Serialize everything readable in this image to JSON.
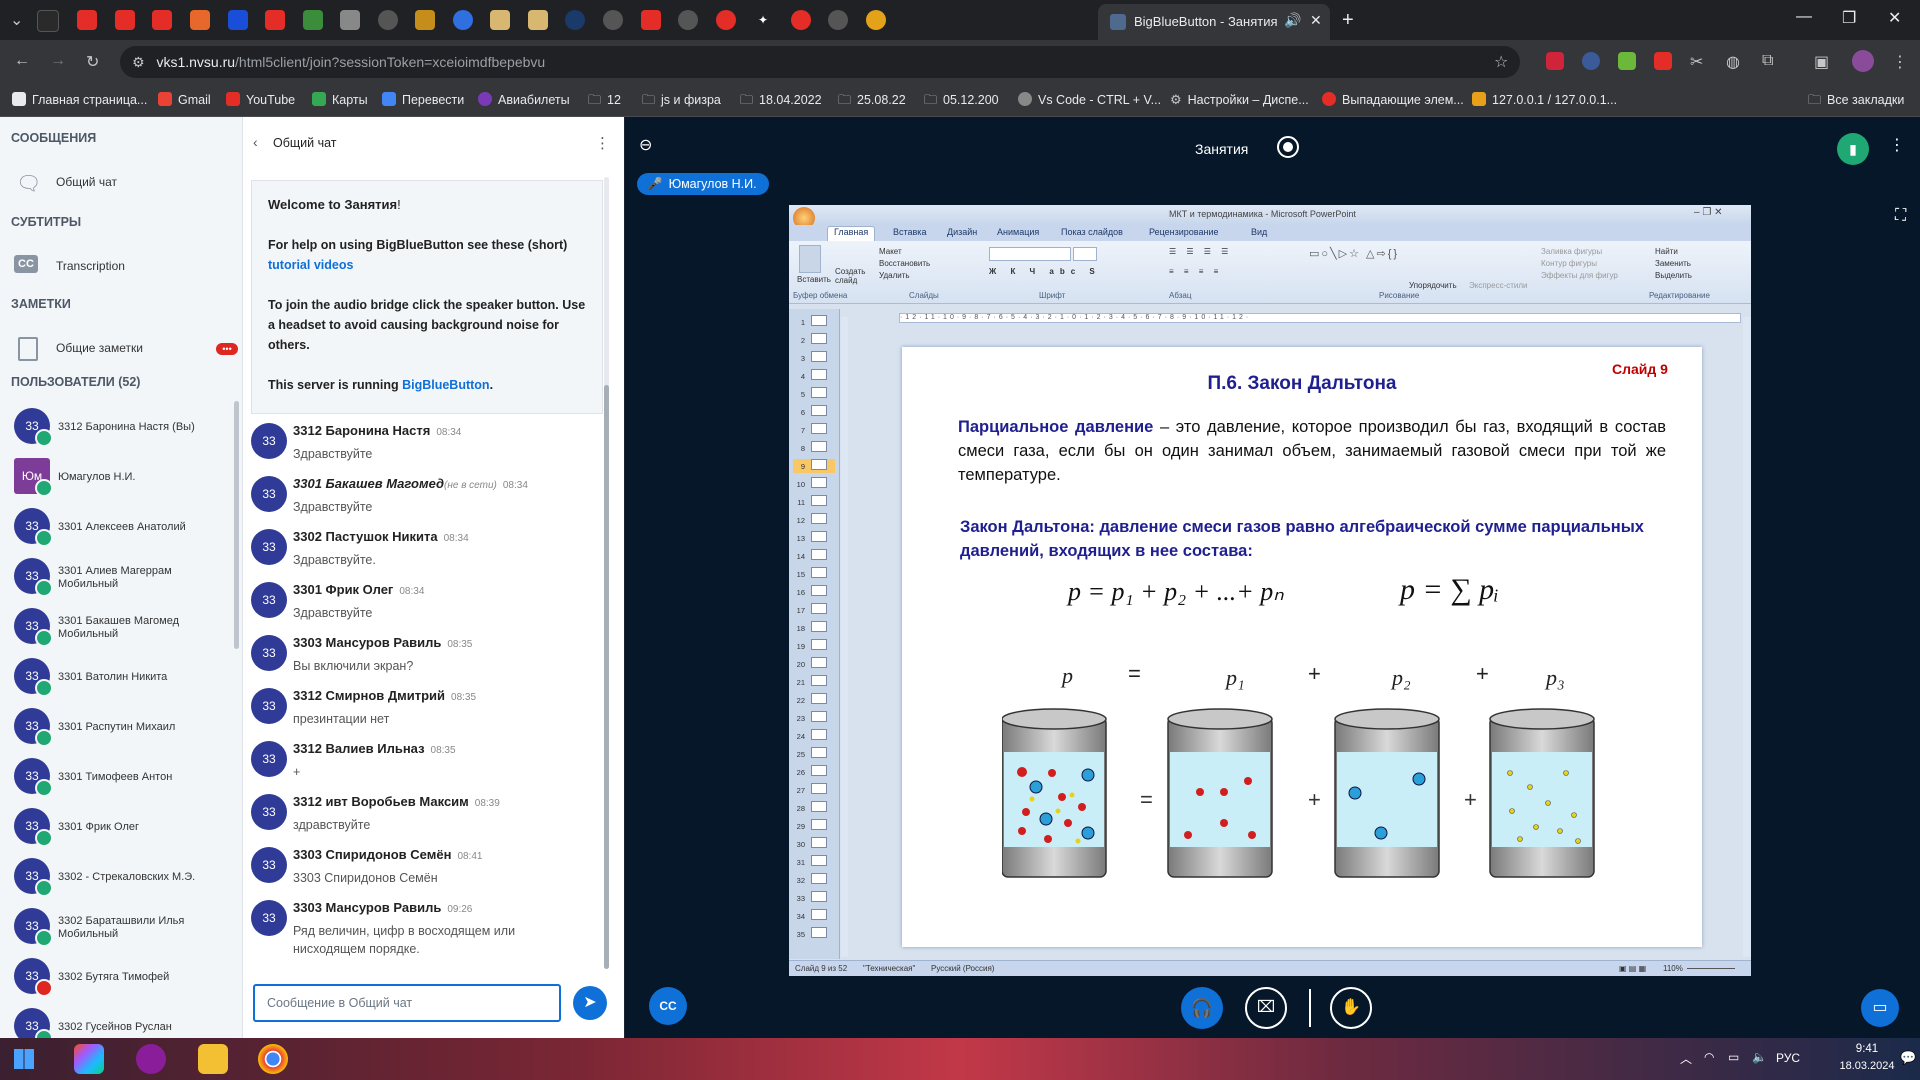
{
  "browser": {
    "active_tab_title": "BigBlueButton - Занятия",
    "url_host": "vks1.nvsu.ru",
    "url_path": "/html5client/join?sessionToken=xceioimdfbepebvu",
    "bookmarks": [
      "Главная страница...",
      "Gmail",
      "YouTube",
      "Карты",
      "Перевести",
      "Авиабилеты",
      "12",
      "js и физра",
      "18.04.2022",
      "25.08.22",
      "05.12.200",
      "Vs Code - CTRL + V...",
      "Настройки – Диспе...",
      "Выпадающие элем...",
      "127.0.0.1 / 127.0.0.1..."
    ],
    "all_bookmarks": "Все закладки"
  },
  "sidebar": {
    "messages_header": "СООБЩЕНИЯ",
    "public_chat": "Общий чат",
    "captions_header": "СУБТИТРЫ",
    "transcription": "Transcription",
    "notes_header": "ЗАМЕТКИ",
    "shared_notes": "Общие заметки",
    "users_header": "ПОЛЬЗОВАТЕЛИ (52)",
    "users": [
      {
        "avatar": "33",
        "name": "3312 Баронина Настя (Вы)"
      },
      {
        "avatar": "Юм",
        "name": "Юмагулов Н.И."
      },
      {
        "avatar": "33",
        "name": "3301 Алексеев Анатолий"
      },
      {
        "avatar": "33",
        "name": "3301 Алиев Магеррам Мобильный"
      },
      {
        "avatar": "33",
        "name": "3301 Бакашев Магомед Мобильный"
      },
      {
        "avatar": "33",
        "name": "3301 Ватолин Никита"
      },
      {
        "avatar": "33",
        "name": "3301 Распутин Михаил"
      },
      {
        "avatar": "33",
        "name": "3301 Тимофеев Антон"
      },
      {
        "avatar": "33",
        "name": "3301 Фрик Олег"
      },
      {
        "avatar": "33",
        "name": "3302 - Стрекаловских М.Э."
      },
      {
        "avatar": "33",
        "name": "3302 Бараташвили Илья Мобильный"
      },
      {
        "avatar": "33",
        "name": "3302 Бутяга Тимофей"
      },
      {
        "avatar": "33",
        "name": "3302 Гусейнов Руслан"
      }
    ]
  },
  "chat": {
    "title": "Общий чат",
    "welcome_prefix": "Welcome to ",
    "welcome_room": "Занятия",
    "welcome_suffix": "!",
    "help_text": "For help on using BigBlueButton see these (short)",
    "help_link": "tutorial videos",
    "audio_text": "To join the audio bridge click the speaker button. Use a headset to avoid causing background noise for others.",
    "server_text": "This server is running ",
    "server_link": "BigBlueButton",
    "messages": [
      {
        "avatar": "33",
        "name": "3312 Баронина Настя",
        "time": "08:34",
        "text": "Здравствуйте"
      },
      {
        "avatar": "33",
        "name": "3301 Бакашев Магомед",
        "status": "(не в сети)",
        "time": "08:34",
        "text": "Здравствуйте"
      },
      {
        "avatar": "33",
        "name": "3302 Пастушок Никита",
        "time": "08:34",
        "text": "Здравствуйте."
      },
      {
        "avatar": "33",
        "name": "3301 Фрик Олег",
        "time": "08:34",
        "text": "Здравствуйте"
      },
      {
        "avatar": "33",
        "name": "3303 Мансуров Равиль",
        "time": "08:35",
        "text": "Вы включили экран?"
      },
      {
        "avatar": "33",
        "name": "3312 Смирнов Дмитрий",
        "time": "08:35",
        "text": "презинтации нет"
      },
      {
        "avatar": "33",
        "name": "3312 Валиев Ильназ",
        "time": "08:35",
        "text": "+"
      },
      {
        "avatar": "33",
        "name": "3312 ивт Воробьев Максим",
        "time": "08:39",
        "text": "здравствуйте"
      },
      {
        "avatar": "33",
        "name": "3303 Спиридонов Семён",
        "time": "08:41",
        "text": "3303 Спиридонов Семён"
      },
      {
        "avatar": "33",
        "name": "3303 Мансуров Равиль",
        "time": "09:26",
        "text": "Ряд величин, цифр в восходящем или нисходящем порядке."
      }
    ],
    "input_placeholder": "Сообщение в Общий чат"
  },
  "meeting": {
    "title": "Занятия",
    "presenter": "Юмагулов Н.И."
  },
  "powerpoint": {
    "window_title": "МКТ и термодинамика - Microsoft PowerPoint",
    "tabs": [
      "Главная",
      "Вставка",
      "Дизайн",
      "Анимация",
      "Показ слайдов",
      "Рецензирование",
      "Вид"
    ],
    "group_labels": [
      "Буфер обмена",
      "Слайды",
      "Шрифт",
      "Абзац",
      "Рисование",
      "Редактирование"
    ],
    "btn_paste": "Вставить",
    "btn_layout": "Макет",
    "btn_reset": "Восстановить",
    "btn_delete": "Удалить",
    "btn_new_slide": "Создать слайд",
    "btn_arrange": "Упорядочить",
    "btn_express": "Экспресс-стили",
    "btn_fill": "Заливка фигуры",
    "btn_outline": "Контур фигуры",
    "btn_effects": "Эффекты для фигур",
    "btn_find": "Найти",
    "btn_replace": "Заменить",
    "btn_select": "Выделить",
    "status_slide": "Слайд 9 из 52",
    "status_theme": "\"Техническая\"",
    "status_lang": "Русский (Россия)",
    "zoom": "110%"
  },
  "slide": {
    "title": "П.6. Закон Дальтона",
    "number": "Слайд 9",
    "term": "Парциальное давление",
    "definition": " – это давление, которое производил бы газ, входящий в состав смеси газа, если бы он один занимал объем, занимаемый газовой смеси при той же температуре.",
    "law_label": "Закон Дальтона:",
    "law_text": " давление смеси газов равно алгебраической сумме парциальных давлений, входящих в нее состава:",
    "formula1": "p = p₁ + p₂ + ...+ pₙ",
    "formula2": "p = ∑ pᵢ",
    "diagram_labels": [
      "p",
      "=",
      "p₁",
      "+",
      "p₂",
      "+",
      "p₃"
    ]
  },
  "taskbar": {
    "lang": "РУС",
    "time": "9:41",
    "date": "18.03.2024"
  },
  "colors": {
    "bbb_blue": "#0f70d7",
    "avatar": "#2f3b96",
    "slide_title_blue": "#1f1f8f",
    "slide_number_red": "#c00000"
  }
}
